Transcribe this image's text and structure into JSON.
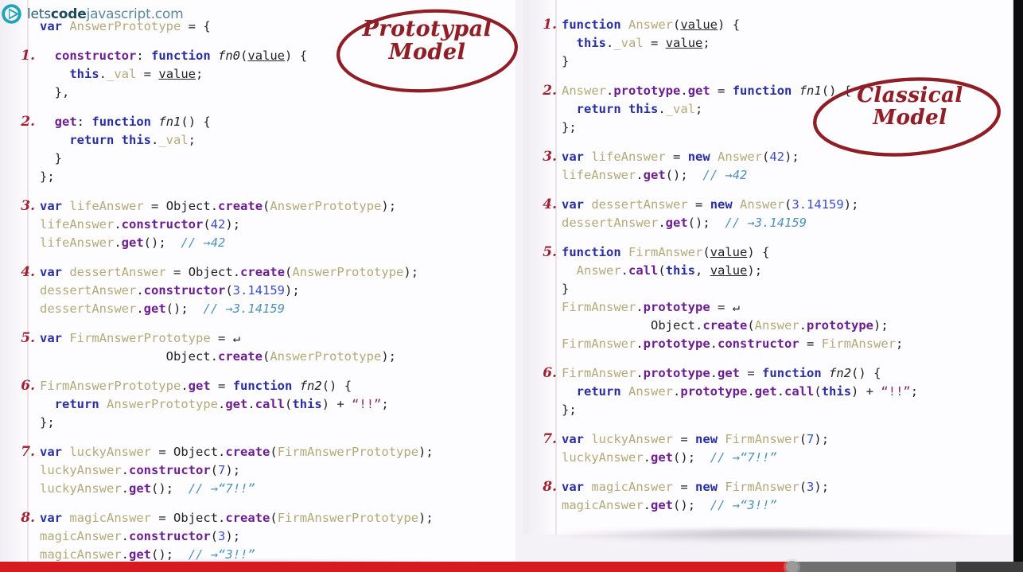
{
  "brand": {
    "logo_icon": "play-circle-logo-icon",
    "name_part1": "lets",
    "name_part2": "code",
    "name_part3": "javascript",
    "name_part4": ".com"
  },
  "annotations": [
    {
      "id": "prototypal",
      "line1": "Prototypal",
      "line2": "Model",
      "color": "#8e1f26",
      "shape": "ellipse"
    },
    {
      "id": "classical",
      "line1": "Classical",
      "line2": "Model",
      "color": "#8e1f26",
      "shape": "ellipse"
    }
  ],
  "left_panel": {
    "title": "Prototypal Model",
    "steps": [
      {
        "num": "",
        "text": "var AnswerPrototype = {"
      },
      {
        "num": "1.",
        "text": "  constructor: function fn0(value) {"
      },
      {
        "num": "",
        "text": "    this._val = value;"
      },
      {
        "num": "",
        "text": "  },"
      },
      {
        "num": "2.",
        "text": "  get: function fn1() {"
      },
      {
        "num": "",
        "text": "    return this._val;"
      },
      {
        "num": "",
        "text": "  }"
      },
      {
        "num": "",
        "text": "};"
      },
      {
        "num": "3.",
        "text": "var lifeAnswer = Object.create(AnswerPrototype);"
      },
      {
        "num": "",
        "text": "lifeAnswer.constructor(42);"
      },
      {
        "num": "",
        "text": "lifeAnswer.get();  // →42"
      },
      {
        "num": "4.",
        "text": "var dessertAnswer = Object.create(AnswerPrototype);"
      },
      {
        "num": "",
        "text": "dessertAnswer.constructor(3.14159);"
      },
      {
        "num": "",
        "text": "dessertAnswer.get();  // →3.14159"
      },
      {
        "num": "5.",
        "text": "var FirmAnswerPrototype = ↵"
      },
      {
        "num": "",
        "text": "                 Object.create(AnswerPrototype);"
      },
      {
        "num": "6.",
        "text": "FirmAnswerPrototype.get = function fn2() {"
      },
      {
        "num": "",
        "text": "  return AnswerPrototype.get.call(this) + “!!”;"
      },
      {
        "num": "",
        "text": "};"
      },
      {
        "num": "7.",
        "text": "var luckyAnswer = Object.create(FirmAnswerPrototype);"
      },
      {
        "num": "",
        "text": "luckyAnswer.constructor(7);"
      },
      {
        "num": "",
        "text": "luckyAnswer.get();  // →“7!!”"
      },
      {
        "num": "8.",
        "text": "var magicAnswer = Object.create(FirmAnswerPrototype);"
      },
      {
        "num": "",
        "text": "magicAnswer.constructor(3);"
      },
      {
        "num": "",
        "text": "magicAnswer.get();  // →“3!!”"
      }
    ]
  },
  "right_panel": {
    "title": "Classical Model",
    "steps": [
      {
        "num": "1.",
        "text": "function Answer(value) {"
      },
      {
        "num": "",
        "text": "  this._val = value;"
      },
      {
        "num": "",
        "text": "}"
      },
      {
        "num": "2.",
        "text": "Answer.prototype.get = function fn1() {"
      },
      {
        "num": "",
        "text": "  return this._val;"
      },
      {
        "num": "",
        "text": "};"
      },
      {
        "num": "3.",
        "text": "var lifeAnswer = new Answer(42);"
      },
      {
        "num": "",
        "text": "lifeAnswer.get();  // →42"
      },
      {
        "num": "4.",
        "text": "var dessertAnswer = new Answer(3.14159);"
      },
      {
        "num": "",
        "text": "dessertAnswer.get();  // →3.14159"
      },
      {
        "num": "5.",
        "text": "function FirmAnswer(value) {"
      },
      {
        "num": "",
        "text": "  Answer.call(this, value);"
      },
      {
        "num": "",
        "text": "}"
      },
      {
        "num": "",
        "text": "FirmAnswer.prototype = ↵"
      },
      {
        "num": "",
        "text": "            Object.create(Answer.prototype);"
      },
      {
        "num": "",
        "text": "FirmAnswer.prototype.constructor = FirmAnswer;"
      },
      {
        "num": "6.",
        "text": "FirmAnswer.prototype.get = function fn2() {"
      },
      {
        "num": "",
        "text": "  return Answer.prototype.get.call(this) + “!!”;"
      },
      {
        "num": "",
        "text": "};"
      },
      {
        "num": "7.",
        "text": "var luckyAnswer = new FirmAnswer(7);"
      },
      {
        "num": "",
        "text": "luckyAnswer.get();  // →“7!!”"
      },
      {
        "num": "8.",
        "text": "var magicAnswer = new FirmAnswer(3);"
      },
      {
        "num": "",
        "text": "magicAnswer.get();  // →“3!!”"
      }
    ]
  },
  "player": {
    "played_percent": 77.3,
    "buffered_percent": 93.5,
    "handle_position_percent": 77.4,
    "played_color": "#d71920",
    "buffered_color": "#6f6f6f",
    "track_color": "#3d3d3d",
    "handle_color": "#9a9a9a"
  },
  "colors": {
    "slide_background": "#fdfcfe",
    "stage_background": "#f4f2f6",
    "keyword": "#2a2f9e",
    "member": "#6c1f8f",
    "identifier": "#b3aa7a",
    "number": "#3b4fc4",
    "string": "#8a2f6a",
    "comment": "#4f93b8",
    "step_number": "#9e2232",
    "annotation": "#8e1f26"
  }
}
